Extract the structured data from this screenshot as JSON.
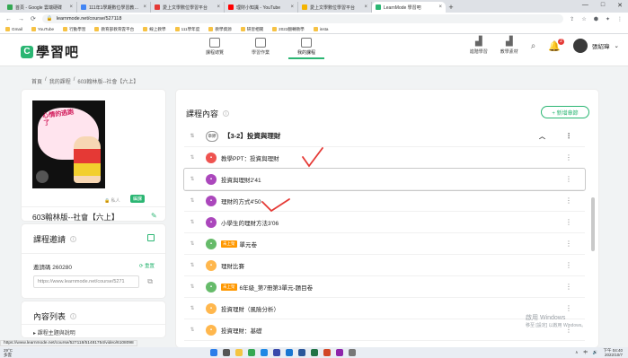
{
  "browser": {
    "tabs": [
      {
        "title": "首頁 - Google 雲端硬碟",
        "color": "#34a853"
      },
      {
        "title": "111年1學期數位學習教學日誌",
        "color": "#4285f4"
      },
      {
        "title": "愛上文學數位學習平台",
        "color": "#e53935"
      },
      {
        "title": "理財小知識 - YouTube",
        "color": "#ff0000"
      },
      {
        "title": "愛上文學數位學習平台",
        "color": "#f4b400"
      },
      {
        "title": "LearnMode 學習吧",
        "color": "#2bb673"
      }
    ],
    "new_tab": "+",
    "window_controls": [
      "—",
      "□",
      "✕"
    ],
    "url": "learnmode.net/course/527118",
    "bookmarks": [
      "Gmail",
      "YouTube",
      "行動學習",
      "教育部教育雲平台",
      "線上教學",
      "111學年度",
      "教學資源",
      "研習相關",
      "2022翻轉教學",
      "insta"
    ]
  },
  "header": {
    "logo_mark": "C",
    "logo_text": "學習吧",
    "nav": [
      {
        "label": "課程總覽",
        "active": false
      },
      {
        "label": "學習作業",
        "active": false
      },
      {
        "label": "我的課程",
        "active": true
      }
    ],
    "right_items": [
      {
        "label": "進階學習",
        "icon": "building-icon"
      },
      {
        "label": "教學素材",
        "icon": "chart-icon"
      }
    ],
    "notification_count": "2",
    "user_name": "張紹瑋"
  },
  "breadcrumb": [
    "首頁",
    "/",
    "我的課程",
    "/",
    "603翰林版--社會【六上】"
  ],
  "course": {
    "cover_text": "心情的逃跑了",
    "privacy": "私人",
    "edit_label": "編課",
    "name": "603翰林版--社會【六上】"
  },
  "invite": {
    "title": "課程邀請",
    "code_label": "邀請碼 260280",
    "reset_label": "重置",
    "link": "https://www.learnmode.net/course/5271"
  },
  "contents_card": {
    "title": "內容列表",
    "first_item": "課程主題與說明"
  },
  "main": {
    "title": "課程內容",
    "add_chapter": "+ 新增章節",
    "chapter_chip": "章節",
    "chapter_title": "【3-2】投資與理財",
    "items": [
      {
        "title": "教學PPT：投資與理財",
        "icon_color": "#ef5350",
        "icon": "ppt-icon",
        "tag": ""
      },
      {
        "title": "投資與理財2'41",
        "icon_color": "#ab47bc",
        "icon": "video-icon",
        "tag": ""
      },
      {
        "title": "理財的方式4'50",
        "icon_color": "#ab47bc",
        "icon": "video-icon",
        "tag": ""
      },
      {
        "title": "小學生的理財方法3'06",
        "icon_color": "#ab47bc",
        "icon": "video-icon",
        "tag": ""
      },
      {
        "title": "單元卷",
        "icon_color": "#66bb6a",
        "icon": "quiz-icon",
        "tag": "未上架"
      },
      {
        "title": "理財比賽",
        "icon_color": "#ffb74d",
        "icon": "link-icon",
        "tag": ""
      },
      {
        "title": "6年級_第7冊第3單元-題目卷",
        "icon_color": "#66bb6a",
        "icon": "quiz-icon",
        "tag": "未上架"
      },
      {
        "title": "投資理財（風險分析）",
        "icon_color": "#ffb74d",
        "icon": "link-icon",
        "tag": ""
      },
      {
        "title": "投資理財：基礎",
        "icon_color": "#ffb74d",
        "icon": "link-icon",
        "tag": ""
      }
    ]
  },
  "watermark": {
    "line1": "啟用 Windows",
    "line2": "移至 [設定] 以啟用 Windows。"
  },
  "status_url": "https://www.learnmode.net/course/527118/51481754/video/6108098",
  "taskbar": {
    "weather_temp": "29°C",
    "weather_desc": "多雲",
    "tray_ime": "中",
    "time": "下午 04:40",
    "date": "2022/10/7"
  }
}
